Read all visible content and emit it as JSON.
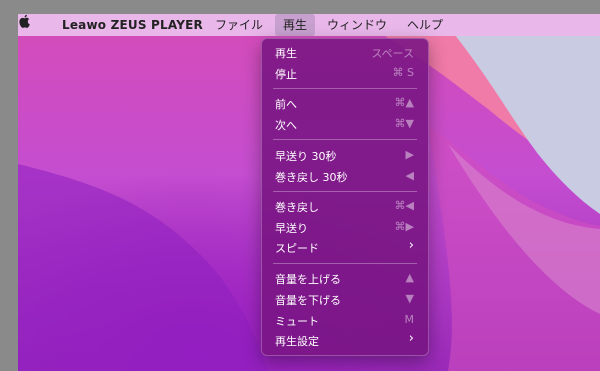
{
  "menubar": {
    "app_name": "Leawo ZEUS PLAYER",
    "menus": [
      "ファイル",
      "再生",
      "ウィンドウ",
      "ヘルプ"
    ]
  },
  "dropdown": {
    "items": [
      {
        "label": "再生",
        "shortcut": "スペース"
      },
      {
        "label": "停止",
        "shortcut": "⌘ S"
      },
      {
        "label": "前へ",
        "shortcut": "⌘▲"
      },
      {
        "label": "次へ",
        "shortcut": "⌘▼"
      },
      {
        "label": "早送り 30秒",
        "shortcut": "▶"
      },
      {
        "label": "巻き戻し 30秒",
        "shortcut": "◀"
      },
      {
        "label": "巻き戻し",
        "shortcut": "⌘◀"
      },
      {
        "label": "早送り",
        "shortcut": "⌘▶"
      },
      {
        "label": "スピード",
        "shortcut": "›"
      },
      {
        "label": "音量を上げる",
        "shortcut": "▲"
      },
      {
        "label": "音量を下げる",
        "shortcut": "▼"
      },
      {
        "label": "ミュート",
        "shortcut": "M"
      },
      {
        "label": "再生設定",
        "shortcut": "›"
      }
    ]
  }
}
